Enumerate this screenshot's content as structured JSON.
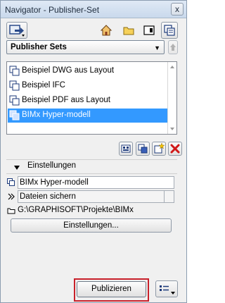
{
  "window": {
    "title": "Navigator - Publisher-Set",
    "close_label": "x"
  },
  "toolbar": {
    "left_button_icon": "navigator-options-icon",
    "tabs": [
      {
        "name": "project-map-tab",
        "icon": "house-icon"
      },
      {
        "name": "view-map-tab",
        "icon": "folder-icon"
      },
      {
        "name": "layout-book-tab",
        "icon": "layout-icon"
      },
      {
        "name": "publisher-sets-tab",
        "icon": "publisher-sets-icon",
        "active": true
      }
    ]
  },
  "dropdown": {
    "label": "Publisher Sets",
    "arrow": "▼"
  },
  "publisher_list": {
    "items": [
      {
        "label": "Beispiel DWG aus Layout",
        "selected": false
      },
      {
        "label": "Beispiel IFC",
        "selected": false
      },
      {
        "label": "Beispiel PDF aus Layout",
        "selected": false
      },
      {
        "label": "BIMx Hyper-modell",
        "selected": true
      }
    ]
  },
  "list_actions": [
    {
      "name": "new-set-button",
      "icon": "new-set-icon"
    },
    {
      "name": "duplicate-set-button",
      "icon": "duplicate-icon"
    },
    {
      "name": "new-folder-button",
      "icon": "new-item-icon"
    },
    {
      "name": "delete-button",
      "icon": "delete-icon"
    }
  ],
  "settings": {
    "header": "Einstellungen",
    "name_field": "BIMx Hyper-modell",
    "save_mode": "Dateien sichern",
    "path": "G:\\GRAPHISOFT\\Projekte\\BIMx",
    "settings_button": "Einstellungen..."
  },
  "footer": {
    "publish_button": "Publizieren"
  },
  "colors": {
    "selection": "#3399ff",
    "highlight": "#c8202a"
  }
}
